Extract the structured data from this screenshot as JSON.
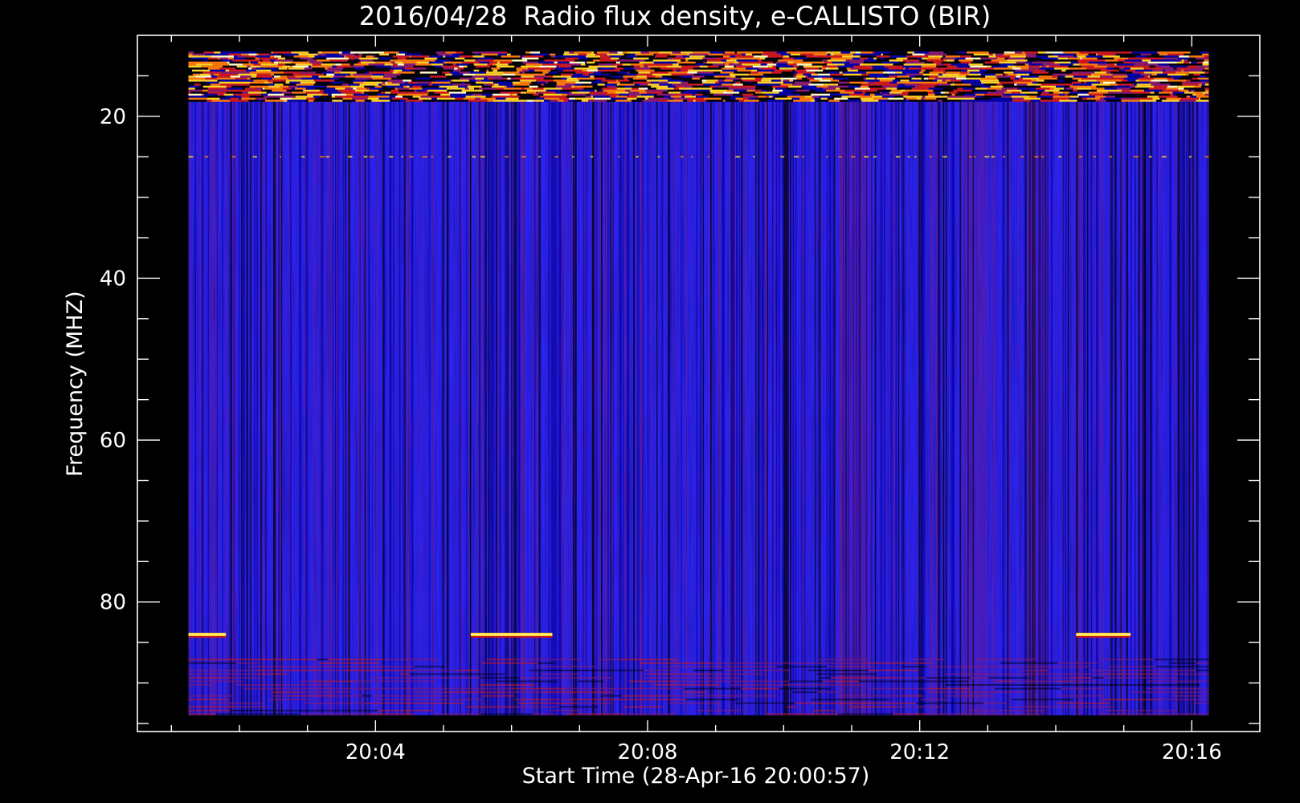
{
  "chart_data": {
    "type": "heatmap",
    "title": "2016/04/28  Radio flux density, e-CALLISTO (BIR)",
    "xlabel": "Start Time (28-Apr-16 20:00:57)",
    "ylabel": "Frequency (MHZ)",
    "x_ticks": [
      {
        "label": "20:04",
        "minutes": 4
      },
      {
        "label": "20:08",
        "minutes": 8
      },
      {
        "label": "20:12",
        "minutes": 12
      },
      {
        "label": "20:16",
        "minutes": 16
      }
    ],
    "y_ticks": [
      20,
      40,
      60,
      80
    ],
    "x_range_minutes": [
      0.5,
      17.0
    ],
    "data_x_range_minutes": [
      1.25,
      16.25
    ],
    "y_range_mhz": [
      10,
      96
    ],
    "data_y_range_mhz": [
      12,
      94
    ],
    "y_reversed": true,
    "colormap": [
      "#000000",
      "#0000a0",
      "#2828ff",
      "#8a1a6a",
      "#d01818",
      "#ff7a00",
      "#ffd21e",
      "#ffffc0"
    ],
    "background_color": "#2a22e6",
    "features": [
      {
        "kind": "RFI band",
        "freq_range_mhz": [
          12,
          18
        ],
        "intensity": "high"
      },
      {
        "kind": "interference line",
        "freq_mhz": 84,
        "time_ranges_minutes": [
          [
            1.25,
            1.8
          ],
          [
            5.4,
            6.6
          ],
          [
            14.3,
            15.1
          ]
        ],
        "intensity": "high"
      },
      {
        "kind": "interference line",
        "freq_mhz": 25,
        "intensity": "weak"
      },
      {
        "kind": "enhanced band",
        "freq_range_mhz": [
          87,
          94
        ],
        "intensity": "moderate"
      }
    ]
  }
}
